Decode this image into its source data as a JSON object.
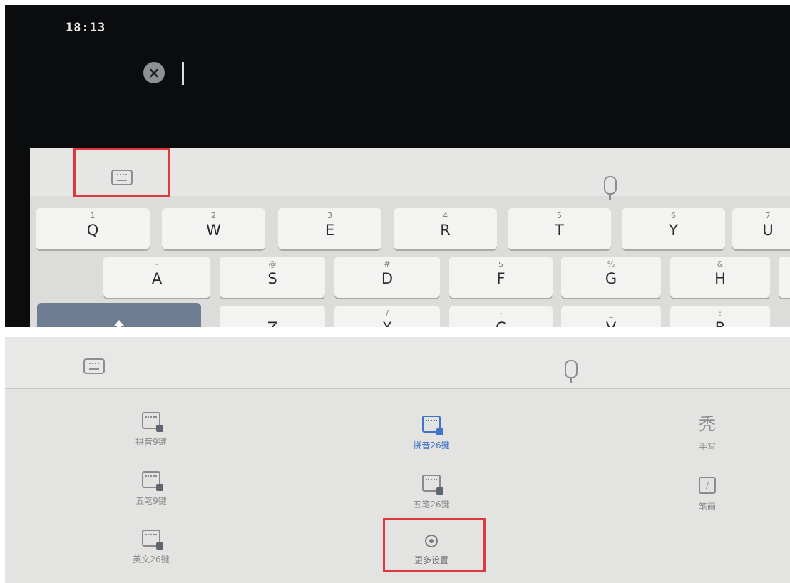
{
  "status": {
    "time": "18:13"
  },
  "keyboard": {
    "rows": [
      [
        {
          "sub": "1",
          "main": "Q"
        },
        {
          "sub": "2",
          "main": "W"
        },
        {
          "sub": "3",
          "main": "E"
        },
        {
          "sub": "4",
          "main": "R"
        },
        {
          "sub": "5",
          "main": "T"
        },
        {
          "sub": "6",
          "main": "Y"
        },
        {
          "sub": "7",
          "main": "U"
        }
      ],
      [
        {
          "sub": "-",
          "main": "A"
        },
        {
          "sub": "@",
          "main": "S"
        },
        {
          "sub": "#",
          "main": "D"
        },
        {
          "sub": "$",
          "main": "F"
        },
        {
          "sub": "%",
          "main": "G"
        },
        {
          "sub": "&",
          "main": "H"
        }
      ],
      [
        {
          "sub": "",
          "main": "Z"
        },
        {
          "sub": "/",
          "main": "X"
        },
        {
          "sub": "-",
          "main": "C"
        },
        {
          "sub": "_",
          "main": "V"
        },
        {
          "sub": ":",
          "main": "B"
        }
      ]
    ]
  },
  "input_modes": {
    "pinyin9": "拼音9键",
    "pinyin26": "拼音26键",
    "handwrite": "手写",
    "wubi9": "五笔9键",
    "wubi26": "五笔26键",
    "stroke": "笔画",
    "english26": "英文26键",
    "more_settings": "更多设置",
    "active_color": "#3f74c8"
  },
  "icons": {
    "handwrite_glyph": "秃"
  }
}
